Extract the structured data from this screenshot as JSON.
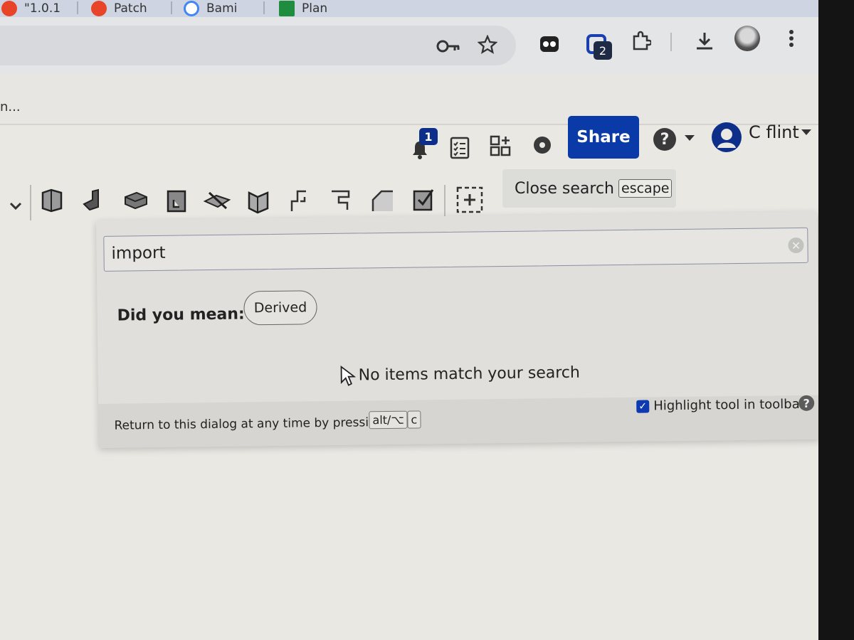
{
  "browser": {
    "tabs": [
      {
        "label": "\"1.0.1",
        "icon": "reddit-icon"
      },
      {
        "label": "Patch",
        "icon": "reddit-icon"
      },
      {
        "label": "Bami",
        "icon": "google-icon"
      },
      {
        "label": "Plan",
        "icon": "sheets-icon"
      }
    ],
    "toolbar_icons": [
      "key-icon",
      "star-icon",
      "extension-icon",
      "extension-icon",
      "puzzle-icon",
      "download-icon",
      "profile-avatar",
      "more-icon"
    ],
    "extension_badge": "2",
    "bookmark_fragment": "n..."
  },
  "app_header": {
    "notification_count": "1",
    "share_label": "Share",
    "user_name": "C flint",
    "icons": [
      "bell-icon",
      "checklist-icon",
      "apps-grid-icon",
      "gear-brain-icon",
      "help-icon",
      "dropdown-icon",
      "avatar-icon"
    ]
  },
  "feature_toolbar": {
    "tools": [
      "extrude-icon",
      "revolve-icon",
      "sweep-icon",
      "loft-icon",
      "thicken-icon",
      "shell-icon",
      "rib-icon",
      "hole-icon",
      "fillet-icon",
      "chamfer-icon",
      "add-tool-icon"
    ],
    "close_search_label": "Close search",
    "close_search_key": "escape"
  },
  "search_dialog": {
    "query": "import",
    "did_you_mean_label": "Did you mean:",
    "suggestion": "Derived",
    "no_results": "No items match your search",
    "footer_text": "Return to this dialog at any time by pressing",
    "shortcut_keys": [
      "alt/⌥",
      "c"
    ],
    "highlight_label": "Highlight tool in toolbar",
    "highlight_checked": true
  }
}
